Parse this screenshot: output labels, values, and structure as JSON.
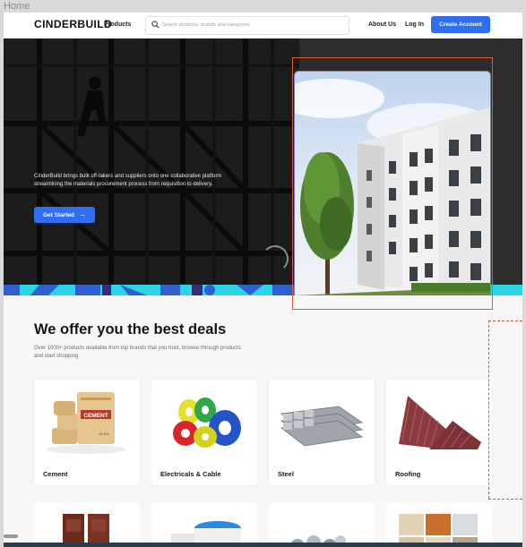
{
  "frame_label": "Home",
  "header": {
    "logo": "CINDERBUILD",
    "products": "Products",
    "search_placeholder": "Search products, brands and categories",
    "about": "About Us",
    "login": "Log In",
    "create_account": "Create Account"
  },
  "hero": {
    "description": "CinderBuild brings bulk off-takers and suppliers onto one collaborative platform streamlining the materials procurement process from requisition to delivery.",
    "cta": "Get Started"
  },
  "deals": {
    "title": "We offer you the best deals",
    "subtitle": "Over 1000+ products available from top brands that you trust, browse through products and start shopping",
    "categories": [
      {
        "label": "Cement"
      },
      {
        "label": "Electricals & Cable"
      },
      {
        "label": "Steel"
      },
      {
        "label": "Roofing"
      }
    ],
    "cement_bag_text": "CEMENT",
    "cement_weight": "25 KG"
  },
  "colors": {
    "accent": "#2f6ef2",
    "hero_bg": "#2b2b2b",
    "strip": "#2bd5e6"
  }
}
